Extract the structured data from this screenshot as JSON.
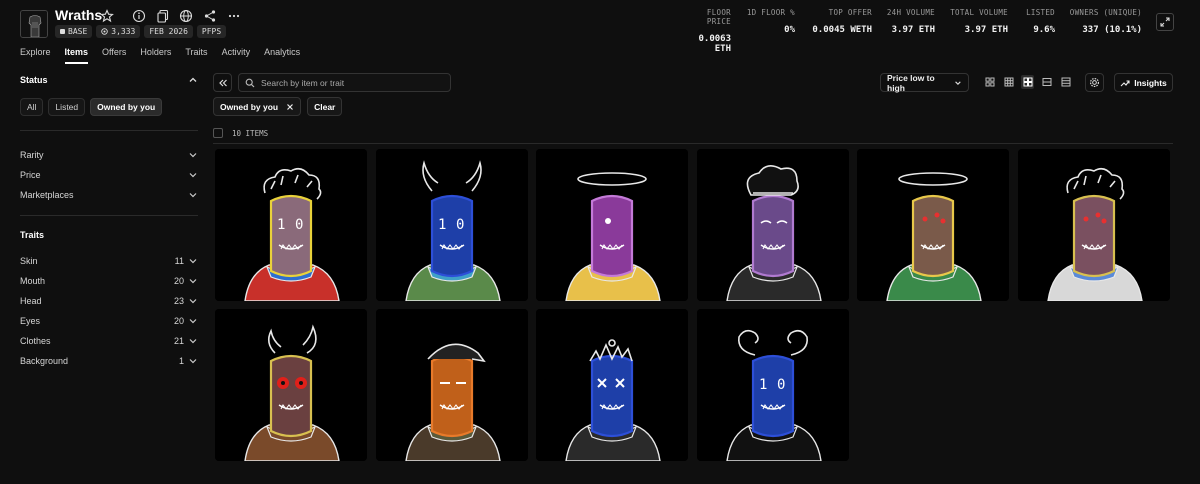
{
  "collection": {
    "name": "Wraths",
    "badges": [
      {
        "icon": "base-chain-icon",
        "text": "BASE"
      },
      {
        "icon": "items-icon",
        "text": "3,333"
      },
      {
        "icon": "",
        "text": "FEB 2026"
      },
      {
        "icon": "",
        "text": "PFPS"
      }
    ]
  },
  "stats": [
    {
      "label": "FLOOR PRICE",
      "value": "0.0063 ETH"
    },
    {
      "label": "1D FLOOR %",
      "value": "0%"
    },
    {
      "label": "TOP OFFER",
      "value": "0.0045 WETH"
    },
    {
      "label": "24H VOLUME",
      "value": "3.97 ETH"
    },
    {
      "label": "TOTAL VOLUME",
      "value": "3.97 ETH"
    },
    {
      "label": "LISTED",
      "value": "9.6%"
    },
    {
      "label": "OWNERS (UNIQUE)",
      "value": "337 (10.1%)"
    }
  ],
  "tabs": [
    "Explore",
    "Items",
    "Offers",
    "Holders",
    "Traits",
    "Activity",
    "Analytics"
  ],
  "active_tab": "Items",
  "sidebar": {
    "status_title": "Status",
    "status_pills": [
      "All",
      "Listed",
      "Owned by you"
    ],
    "active_status": "Owned by you",
    "filters": [
      "Rarity",
      "Price",
      "Marketplaces"
    ],
    "traits_title": "Traits",
    "traits": [
      {
        "name": "Skin",
        "count": "11"
      },
      {
        "name": "Mouth",
        "count": "20"
      },
      {
        "name": "Head",
        "count": "23"
      },
      {
        "name": "Eyes",
        "count": "20"
      },
      {
        "name": "Clothes",
        "count": "21"
      },
      {
        "name": "Background",
        "count": "1"
      }
    ]
  },
  "toolbar": {
    "search_placeholder": "Search by item or trait",
    "sort_label": "Price low to high",
    "insights_label": "Insights"
  },
  "chips": {
    "active_filter": "Owned by you",
    "clear_label": "Clear"
  },
  "items_count": "10 ITEMS",
  "items": [
    {
      "skin": "#8a6a7a",
      "accent": "#e9d23a",
      "eyes": "10",
      "clothes": "#c8302a",
      "head": "hair",
      "collar": "#2e6fd0"
    },
    {
      "skin": "#1e3fa8",
      "accent": "#2d4fd8",
      "eyes": "10",
      "clothes": "#5a8a4a",
      "head": "horns",
      "collar": "#3fa0c8"
    },
    {
      "skin": "#8a3a9a",
      "accent": "#c47ad8",
      "eyes": "o",
      "clothes": "#e8c04a",
      "head": "halo",
      "collar": "#e8c04a"
    },
    {
      "skin": "#6a4a8a",
      "accent": "#b07ad0",
      "eyes": "eyes",
      "clothes": "#2a2a2a",
      "head": "chef",
      "collar": "#2a2a2a"
    },
    {
      "skin": "#7a5a4a",
      "accent": "#e8c84a",
      "eyes": "three",
      "clothes": "#3a8a4a",
      "head": "halo",
      "collar": "#3a8a4a"
    },
    {
      "skin": "#7a5060",
      "accent": "#d8c050",
      "eyes": "three",
      "clothes": "#d8d8d8",
      "head": "hair",
      "collar": "#5a8ad8"
    },
    {
      "skin": "#6a4040",
      "accent": "#d8c050",
      "eyes": "red",
      "clothes": "#7a4a2a",
      "head": "horns2",
      "collar": "#7a4a2a"
    },
    {
      "skin": "#c0601a",
      "accent": "#e87a2a",
      "eyes": "sleepy",
      "clothes": "#4a3a2a",
      "head": "bandana",
      "collar": "#5a5a3a"
    },
    {
      "skin": "#1e3fa8",
      "accent": "#2d4fd8",
      "eyes": "x",
      "clothes": "#2a2a2a",
      "head": "spikes",
      "collar": "#2a2a2a"
    },
    {
      "skin": "#1e3fa8",
      "accent": "#2d4fd8",
      "eyes": "10",
      "clothes": "#111111",
      "head": "ram",
      "collar": "#111111"
    }
  ]
}
